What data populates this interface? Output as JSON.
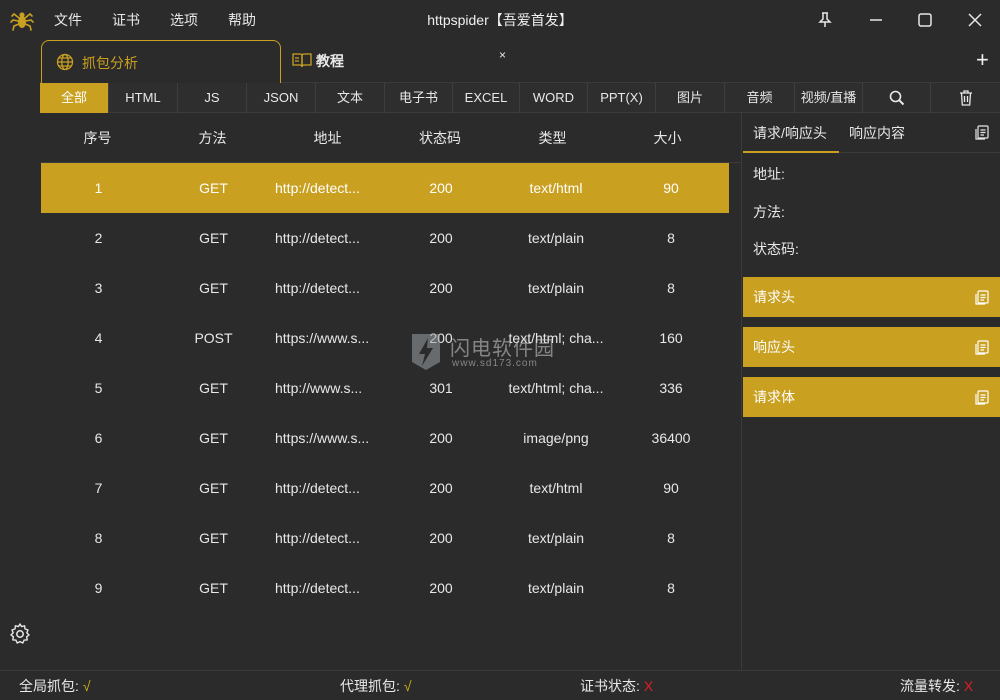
{
  "app": {
    "title": "httpspider【吾爱首发】",
    "menu": [
      "文件",
      "证书",
      "选项",
      "帮助"
    ]
  },
  "tabs": [
    {
      "label": "抓包分析",
      "icon": "globe-icon"
    },
    {
      "label": "教程",
      "icon": "book-icon",
      "close": "×"
    }
  ],
  "add_tab": "+",
  "filters": [
    "全部",
    "HTML",
    "JS",
    "JSON",
    "文本",
    "电子书",
    "EXCEL",
    "WORD",
    "PPT(X)",
    "图片",
    "音频",
    "视频/直播"
  ],
  "table": {
    "headers": [
      "序号",
      "方法",
      "地址",
      "状态码",
      "类型",
      "大小"
    ],
    "rows": [
      {
        "id": "1",
        "method": "GET",
        "url": "http://detect...",
        "status": "200",
        "type": "text/html",
        "size": "90"
      },
      {
        "id": "2",
        "method": "GET",
        "url": "http://detect...",
        "status": "200",
        "type": "text/plain",
        "size": "8"
      },
      {
        "id": "3",
        "method": "GET",
        "url": "http://detect...",
        "status": "200",
        "type": "text/plain",
        "size": "8"
      },
      {
        "id": "4",
        "method": "POST",
        "url": "https://www.s...",
        "status": "200",
        "type": "text/html; cha...",
        "size": "160"
      },
      {
        "id": "5",
        "method": "GET",
        "url": "http://www.s...",
        "status": "301",
        "type": "text/html; cha...",
        "size": "336"
      },
      {
        "id": "6",
        "method": "GET",
        "url": "https://www.s...",
        "status": "200",
        "type": "image/png",
        "size": "36400"
      },
      {
        "id": "7",
        "method": "GET",
        "url": "http://detect...",
        "status": "200",
        "type": "text/html",
        "size": "90"
      },
      {
        "id": "8",
        "method": "GET",
        "url": "http://detect...",
        "status": "200",
        "type": "text/plain",
        "size": "8"
      },
      {
        "id": "9",
        "method": "GET",
        "url": "http://detect...",
        "status": "200",
        "type": "text/plain",
        "size": "8"
      }
    ]
  },
  "panel": {
    "tabs": [
      "请求/响应头",
      "响应内容"
    ],
    "fields": [
      "地址:",
      "方法:",
      "状态码:"
    ],
    "sections": [
      "请求头",
      "响应头",
      "请求体"
    ]
  },
  "watermark": {
    "main": "闪电软件园",
    "sub": "www.sd173.com"
  },
  "status": {
    "global_capture": {
      "label": "全局抓包:",
      "value": "√"
    },
    "proxy_capture": {
      "label": "代理抓包:",
      "value": "√"
    },
    "cert_status": {
      "label": "证书状态:",
      "value": "X"
    },
    "traffic_forward": {
      "label": "流量转发:",
      "value": "X"
    }
  },
  "colors": {
    "accent": "#c9a020",
    "background": "#2b2b2b",
    "error": "#e02020"
  }
}
